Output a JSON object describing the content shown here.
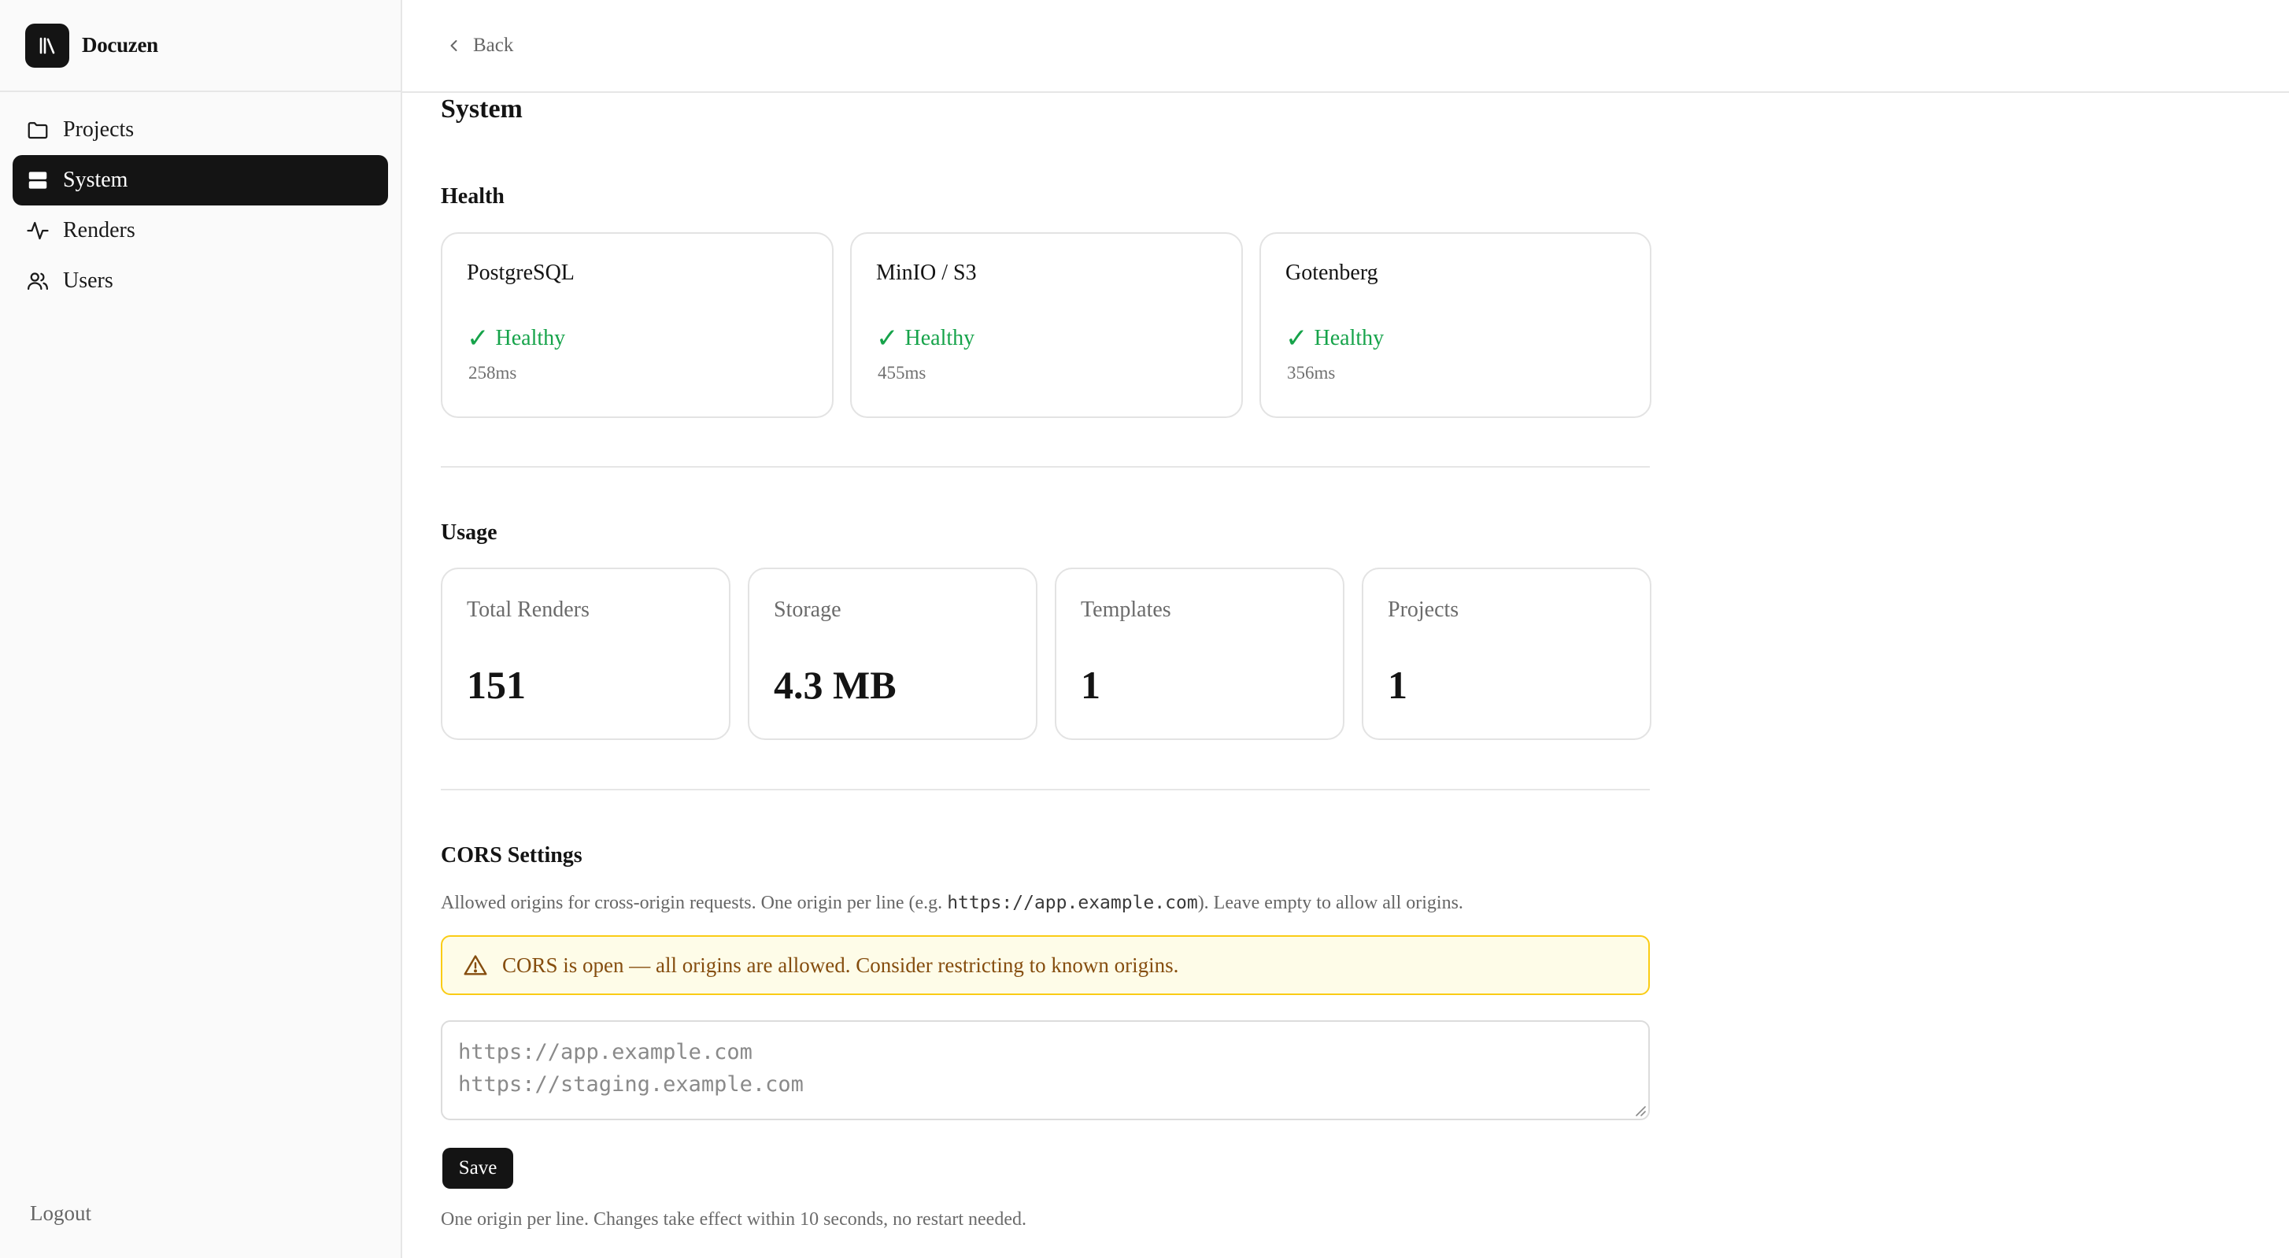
{
  "brand": {
    "name": "Docuzen"
  },
  "sidebar": {
    "items": [
      {
        "label": "Projects",
        "icon": "folder-icon",
        "active": false
      },
      {
        "label": "System",
        "icon": "server-icon",
        "active": true
      },
      {
        "label": "Renders",
        "icon": "activity-icon",
        "active": false
      },
      {
        "label": "Users",
        "icon": "users-icon",
        "active": false
      }
    ],
    "logout_label": "Logout"
  },
  "topbar": {
    "back_label": "Back"
  },
  "page": {
    "title": "System"
  },
  "health": {
    "title": "Health",
    "services": [
      {
        "name": "PostgreSQL",
        "status": "Healthy",
        "latency": "258ms"
      },
      {
        "name": "MinIO / S3",
        "status": "Healthy",
        "latency": "455ms"
      },
      {
        "name": "Gotenberg",
        "status": "Healthy",
        "latency": "356ms"
      }
    ],
    "status_color": "#16a34a"
  },
  "usage": {
    "title": "Usage",
    "stats": [
      {
        "label": "Total Renders",
        "value": "151"
      },
      {
        "label": "Storage",
        "value": "4.3 MB"
      },
      {
        "label": "Templates",
        "value": "1"
      },
      {
        "label": "Projects",
        "value": "1"
      }
    ]
  },
  "cors": {
    "title": "CORS Settings",
    "desc_before": "Allowed origins for cross-origin requests. One origin per line (e.g. ",
    "desc_code": "https://app.example.com",
    "desc_after": "). Leave empty to allow all origins.",
    "warning": "CORS is open — all origins are allowed. Consider restricting to known origins.",
    "placeholder": "https://app.example.com\nhttps://staging.example.com",
    "value": "",
    "save_label": "Save",
    "hint": "One origin per line. Changes take effect within 10 seconds, no restart needed."
  }
}
